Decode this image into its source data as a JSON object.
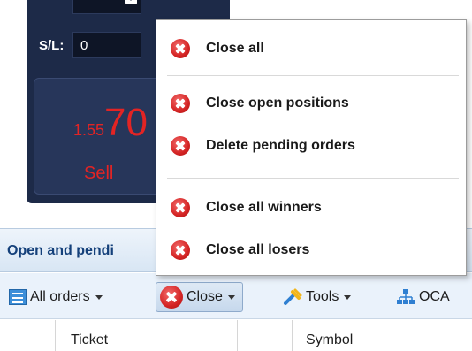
{
  "trade_panel": {
    "sl_label": "S/L:",
    "sl_value": "0",
    "price_small": "1.55",
    "price_big": "70",
    "sell_label": "Sell"
  },
  "menu": {
    "items": [
      {
        "label": "Close all"
      },
      {
        "label": "Close open positions"
      },
      {
        "label": "Delete pending orders"
      },
      {
        "label": "Close all winners"
      },
      {
        "label": "Close all losers"
      }
    ]
  },
  "section": {
    "title": "Open and pendi"
  },
  "toolbar": {
    "all_orders": "All orders",
    "close": "Close",
    "tools": "Tools",
    "oca": "OCA"
  },
  "table": {
    "columns": [
      "Ticket",
      "Symbol"
    ]
  },
  "colors": {
    "panel_bg": "#1d2a48",
    "sell_red": "#e32424",
    "header_text": "#14407a",
    "icon_red": "#d42424"
  }
}
